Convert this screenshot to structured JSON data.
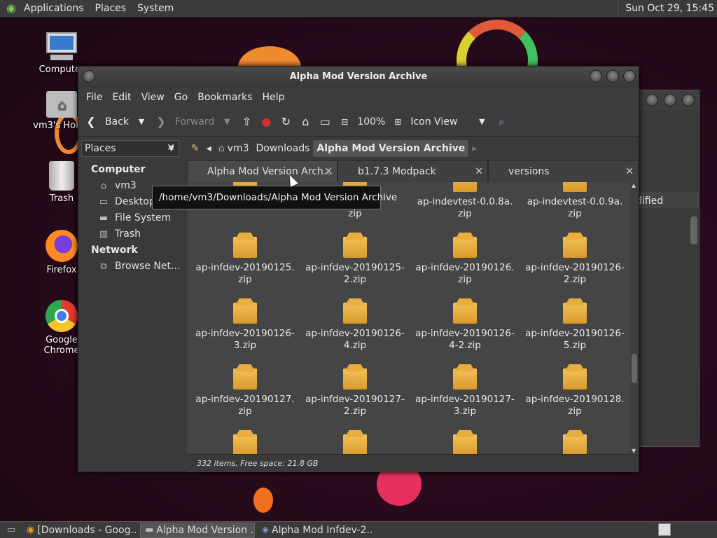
{
  "top_panel": {
    "menus": [
      "Applications",
      "Places",
      "System"
    ],
    "clock": "Sun Oct 29, 15:45"
  },
  "desktop_icons": [
    {
      "label": "Computer",
      "icon": "computer-icon"
    },
    {
      "label": "vm3's Home",
      "icon": "home-folder-icon"
    },
    {
      "label": "Trash",
      "icon": "trash-icon"
    },
    {
      "label": "Firefox",
      "icon": "firefox-icon"
    },
    {
      "label": "Google Chrome",
      "icon": "chrome-icon"
    }
  ],
  "window": {
    "title": "Alpha Mod Version Archive",
    "menu": [
      "File",
      "Edit",
      "View",
      "Go",
      "Bookmarks",
      "Help"
    ],
    "toolbar": {
      "back": "Back",
      "forward": "Forward",
      "zoom": "100%",
      "view_mode": "Icon View"
    },
    "places_selector": "Places",
    "breadcrumbs": [
      "vm3",
      "Downloads",
      "Alpha Mod Version Archive"
    ],
    "sidebar": {
      "computer_header": "Computer",
      "computer_items": [
        "vm3",
        "Desktop",
        "File System",
        "Trash"
      ],
      "network_header": "Network",
      "network_items": [
        "Browse Net..."
      ]
    },
    "tabs": [
      {
        "label": "Alpha Mod Version Arch...",
        "active": true
      },
      {
        "label": "b1.7.3 Modpack",
        "active": false
      },
      {
        "label": "versions",
        "active": false
      }
    ],
    "tooltip": "/home/vm3/Downloads/Alpha Mod Version Archive",
    "files": [
      {
        "line1": "",
        "line2": "zip"
      },
      {
        "line1": "…7a.",
        "line2": "zip"
      },
      {
        "line1": "ap-indevtest-0.0.8a.",
        "line2": "zip"
      },
      {
        "line1": "ap-indevtest-0.0.9a.",
        "line2": "zip"
      },
      {
        "line1": "ap-infdev-20190125.",
        "line2": "zip"
      },
      {
        "line1": "ap-infdev-20190125-",
        "line2": "2.zip"
      },
      {
        "line1": "ap-infdev-20190126.",
        "line2": "zip"
      },
      {
        "line1": "ap-infdev-20190126-",
        "line2": "2.zip"
      },
      {
        "line1": "ap-infdev-20190126-",
        "line2": "3.zip"
      },
      {
        "line1": "ap-infdev-20190126-",
        "line2": "4.zip"
      },
      {
        "line1": "ap-infdev-20190126-",
        "line2": "4-2.zip"
      },
      {
        "line1": "ap-infdev-20190126-",
        "line2": "5.zip"
      },
      {
        "line1": "ap-infdev-20190127.",
        "line2": "zip"
      },
      {
        "line1": "ap-infdev-20190127-",
        "line2": "2.zip"
      },
      {
        "line1": "ap-infdev-20190127-",
        "line2": "3.zip"
      },
      {
        "line1": "ap-infdev-20190128.",
        "line2": "zip"
      }
    ],
    "status": "332 items, Free space: 21.8 GB"
  },
  "back_window_fragment": "dified",
  "taskbar": [
    {
      "label": "[Downloads - Goog...",
      "active": false
    },
    {
      "label": "Alpha Mod Version ...",
      "active": true
    },
    {
      "label": "Alpha Mod Infdev-2...",
      "active": false
    }
  ]
}
